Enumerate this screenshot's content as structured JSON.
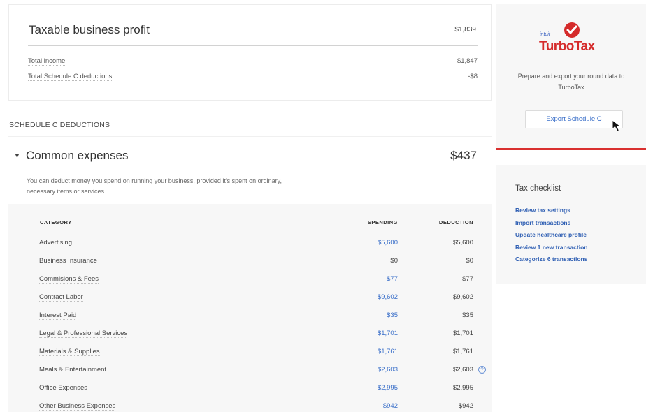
{
  "profit": {
    "title": "Taxable business profit",
    "total": "$1,839",
    "rows": [
      {
        "label": "Total income",
        "value": "$1,847"
      },
      {
        "label": "Total Schedule C deductions",
        "value": "-$8"
      }
    ]
  },
  "section_label": "SCHEDULE C DEDUCTIONS",
  "common": {
    "caret": "▼",
    "title": "Common expenses",
    "amount": "$437",
    "description": "You can deduct money you spend on running your business, provided it's spent on ordinary, necessary items or services."
  },
  "table": {
    "headers": {
      "category": "CATEGORY",
      "spending": "SPENDING",
      "deduction": "DEDUCTION"
    },
    "rows": [
      {
        "category": "Advertising",
        "spending": "$5,600",
        "deduction": "$5,600"
      },
      {
        "category": "Business Insurance",
        "spending": "$0",
        "deduction": "$0"
      },
      {
        "category": "Commisions & Fees",
        "spending": "$77",
        "deduction": "$77"
      },
      {
        "category": "Contract Labor",
        "spending": "$9,602",
        "deduction": "$9,602"
      },
      {
        "category": "Interest Paid",
        "spending": "$35",
        "deduction": "$35"
      },
      {
        "category": "Legal & Professional Services",
        "spending": "$1,701",
        "deduction": "$1,701"
      },
      {
        "category": "Materials & Supplies",
        "spending": "$1,761",
        "deduction": "$1,761"
      },
      {
        "category": "Meals & Entertainment",
        "spending": "$2,603",
        "deduction": "$2,603"
      },
      {
        "category": "Office Expenses",
        "spending": "$2,995",
        "deduction": "$2,995"
      },
      {
        "category": "Other Business Expenses",
        "spending": "$942",
        "deduction": "$942"
      }
    ]
  },
  "turbotax": {
    "intuit": "intuit",
    "brand": "TurboTax",
    "description": "Prepare and export your round data to TurboTax",
    "button": "Export Schedule C",
    "brand_color": "#d52b2b"
  },
  "checklist": {
    "title": "Tax checklist",
    "items": [
      "Review tax settings",
      "Import transactions",
      "Update healthcare profile",
      "Review 1 new transaction",
      "Categorize 6 transactions"
    ]
  },
  "colors": {
    "link": "#3a6fc9",
    "accent_red": "#d9302f"
  }
}
